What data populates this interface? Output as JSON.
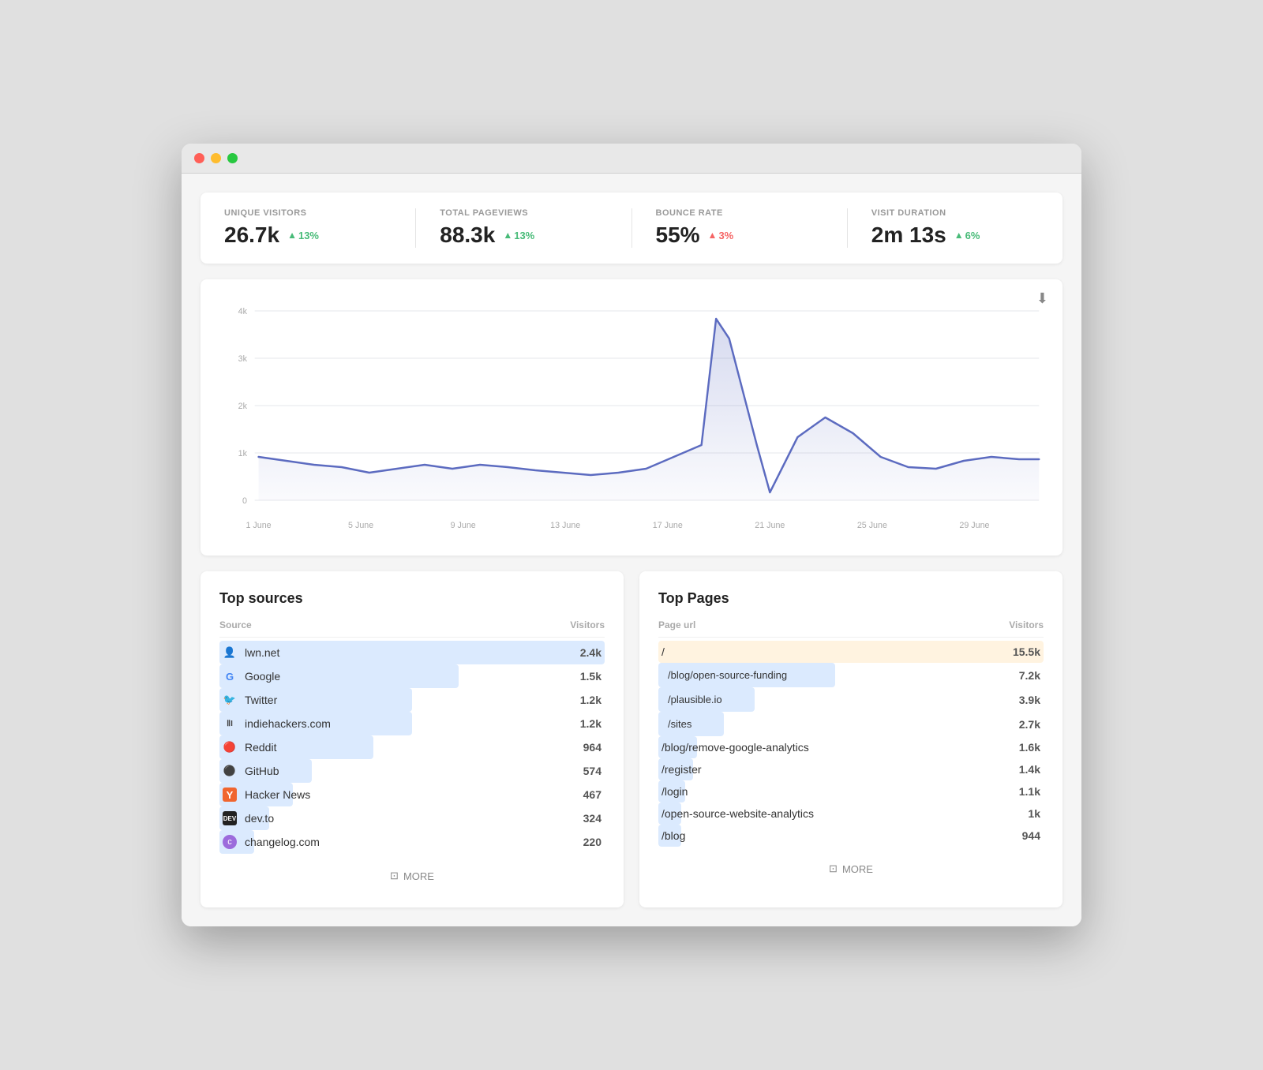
{
  "window": {
    "dots": [
      "red",
      "yellow",
      "green"
    ]
  },
  "stats": [
    {
      "id": "unique-visitors",
      "label": "UNIQUE VISITORS",
      "value": "26.7k",
      "change": "13%",
      "direction": "up",
      "color": "green"
    },
    {
      "id": "total-pageviews",
      "label": "TOTAL PAGEVIEWS",
      "value": "88.3k",
      "change": "13%",
      "direction": "up",
      "color": "green"
    },
    {
      "id": "bounce-rate",
      "label": "BOUNCE RATE",
      "value": "55%",
      "change": "3%",
      "direction": "up",
      "color": "red"
    },
    {
      "id": "visit-duration",
      "label": "VISIT DURATION",
      "value": "2m 13s",
      "change": "6%",
      "direction": "up",
      "color": "green"
    }
  ],
  "chart": {
    "y_labels": [
      "4k",
      "3k",
      "2k",
      "1k",
      "0"
    ],
    "x_labels": [
      "1 June",
      "5 June",
      "9 June",
      "13 June",
      "17 June",
      "21 June",
      "25 June",
      "29 June"
    ],
    "download_label": "⬇"
  },
  "top_sources": {
    "title": "Top sources",
    "col_source": "Source",
    "col_visitors": "Visitors",
    "more_label": "MORE",
    "rows": [
      {
        "name": "lwn.net",
        "value": "2.4k",
        "bar_pct": 100,
        "icon": "👤",
        "bar_color": "#dbeafe"
      },
      {
        "name": "Google",
        "value": "1.5k",
        "bar_pct": 62,
        "icon": "G",
        "icon_color": "#4285F4",
        "bar_color": "#dbeafe"
      },
      {
        "name": "Twitter",
        "value": "1.2k",
        "bar_pct": 50,
        "icon": "🐦",
        "bar_color": "#dbeafe"
      },
      {
        "name": "indiehackers.com",
        "value": "1.2k",
        "bar_pct": 50,
        "icon": "ⅡI",
        "bar_color": "#dbeafe"
      },
      {
        "name": "Reddit",
        "value": "964",
        "bar_pct": 40,
        "icon": "🔴",
        "bar_color": "#dbeafe"
      },
      {
        "name": "GitHub",
        "value": "574",
        "bar_pct": 24,
        "icon": "⚫",
        "bar_color": "#dbeafe"
      },
      {
        "name": "Hacker News",
        "value": "467",
        "bar_pct": 19,
        "icon": "Y",
        "icon_color": "#f0652f",
        "bar_color": "#dbeafe"
      },
      {
        "name": "dev.to",
        "value": "324",
        "bar_pct": 13,
        "icon": "DEV",
        "bar_color": "#dbeafe"
      },
      {
        "name": "changelog.com",
        "value": "220",
        "bar_pct": 9,
        "icon": "c",
        "bar_color": "#dbeafe"
      }
    ]
  },
  "top_pages": {
    "title": "Top Pages",
    "col_page": "Page url",
    "col_visitors": "Visitors",
    "more_label": "MORE",
    "rows": [
      {
        "url": "/",
        "value": "15.5k",
        "bar_pct": 100,
        "bar_color": "#fff3e0"
      },
      {
        "url": "/blog/open-source-funding",
        "value": "7.2k",
        "bar_pct": 46,
        "bar_color": "#dbeafe"
      },
      {
        "url": "/plausible.io",
        "value": "3.9k",
        "bar_pct": 25,
        "bar_color": "#dbeafe"
      },
      {
        "url": "/sites",
        "value": "2.7k",
        "bar_pct": 17,
        "bar_color": "#dbeafe"
      },
      {
        "url": "/blog/remove-google-analytics",
        "value": "1.6k",
        "bar_pct": 10,
        "bar_color": "#dbeafe"
      },
      {
        "url": "/register",
        "value": "1.4k",
        "bar_pct": 9,
        "bar_color": "#dbeafe"
      },
      {
        "url": "/login",
        "value": "1.1k",
        "bar_pct": 7,
        "bar_color": "#dbeafe"
      },
      {
        "url": "/open-source-website-analytics",
        "value": "1k",
        "bar_pct": 6,
        "bar_color": "#dbeafe"
      },
      {
        "url": "/blog",
        "value": "944",
        "bar_pct": 6,
        "bar_color": "#dbeafe"
      }
    ]
  }
}
